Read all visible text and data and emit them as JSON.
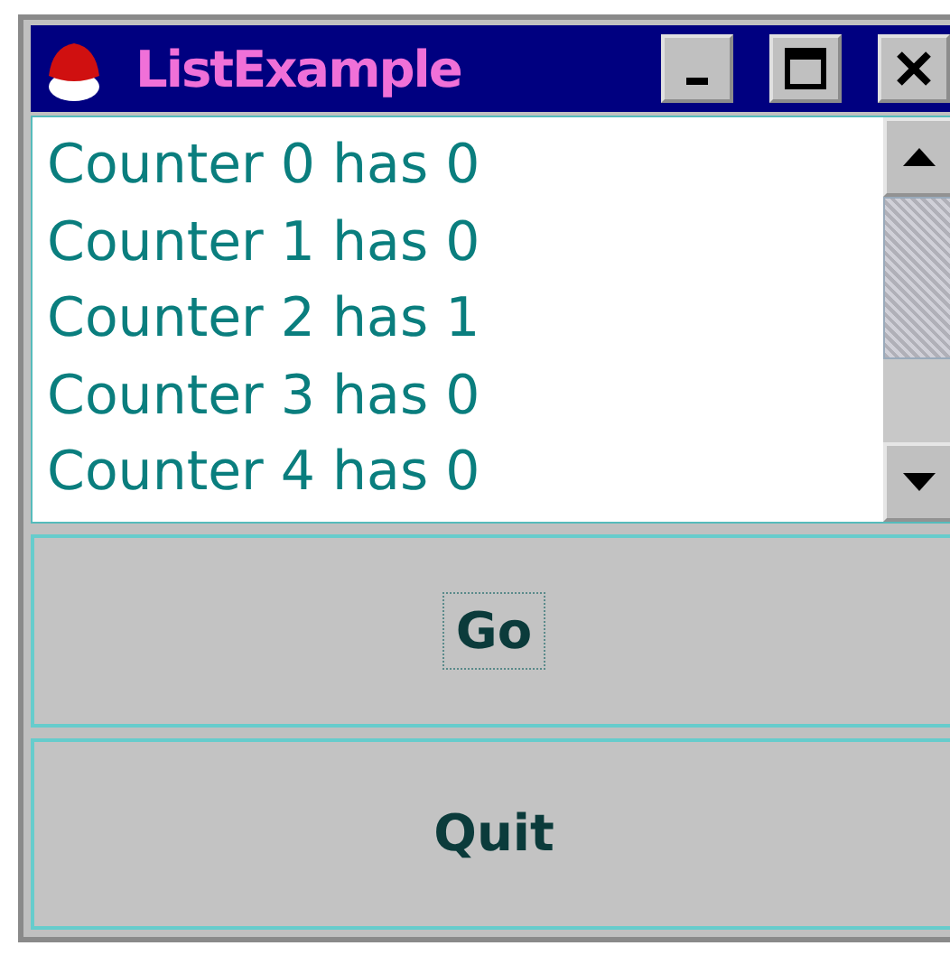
{
  "window": {
    "title": "ListExample"
  },
  "list": {
    "items": [
      "Counter 0 has 0",
      "Counter 1 has 0",
      "Counter 2 has 1",
      "Counter 3 has 0",
      "Counter 4 has 0"
    ]
  },
  "buttons": [
    {
      "label": "Go",
      "focused": true
    },
    {
      "label": "Quit",
      "focused": false
    }
  ]
}
